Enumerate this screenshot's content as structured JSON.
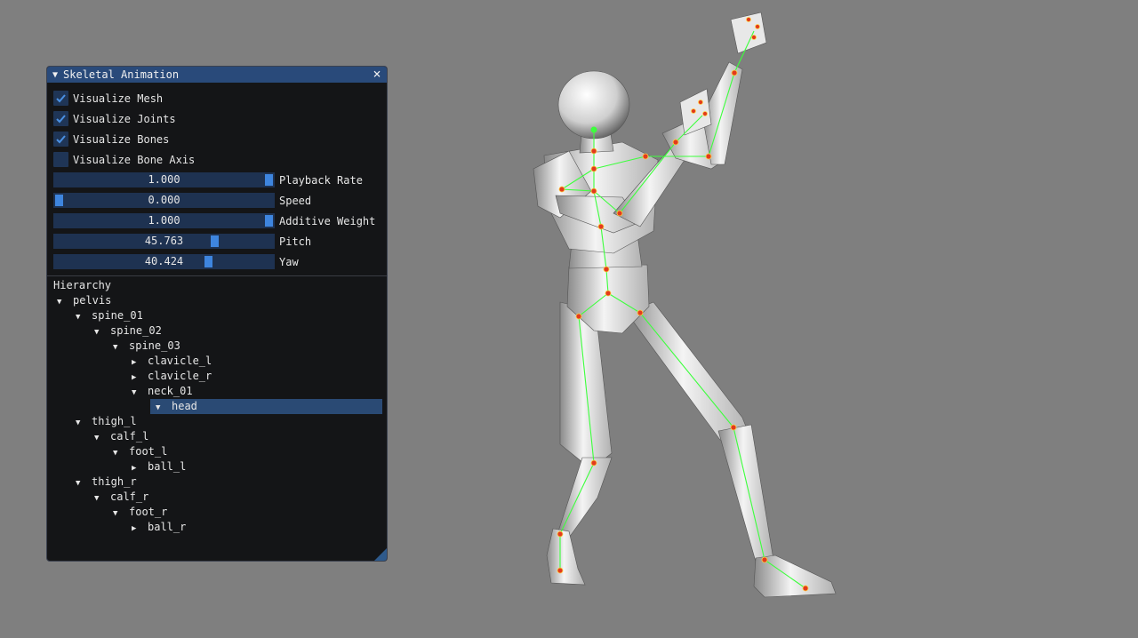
{
  "window": {
    "title": "Skeletal Animation",
    "checkboxes": [
      {
        "label": "Visualize Mesh",
        "checked": true
      },
      {
        "label": "Visualize Joints",
        "checked": true
      },
      {
        "label": "Visualize Bones",
        "checked": true
      },
      {
        "label": "Visualize Bone Axis",
        "checked": false
      }
    ],
    "sliders": [
      {
        "label": "Playback Rate",
        "value": "1.000",
        "fraction": 1.0
      },
      {
        "label": "Speed",
        "value": "0.000",
        "fraction": 0.0
      },
      {
        "label": "Additive Weight",
        "value": "1.000",
        "fraction": 1.0
      },
      {
        "label": "Pitch",
        "value": "45.763",
        "fraction": 0.74
      },
      {
        "label": "Yaw",
        "value": "40.424",
        "fraction": 0.71
      }
    ],
    "hierarchy": {
      "title": "Hierarchy",
      "nodes": [
        {
          "label": "pelvis",
          "depth": 0,
          "expanded": true,
          "selected": false
        },
        {
          "label": "spine_01",
          "depth": 1,
          "expanded": true,
          "selected": false
        },
        {
          "label": "spine_02",
          "depth": 2,
          "expanded": true,
          "selected": false
        },
        {
          "label": "spine_03",
          "depth": 3,
          "expanded": true,
          "selected": false
        },
        {
          "label": "clavicle_l",
          "depth": 4,
          "expanded": false,
          "selected": false
        },
        {
          "label": "clavicle_r",
          "depth": 4,
          "expanded": false,
          "selected": false
        },
        {
          "label": "neck_01",
          "depth": 4,
          "expanded": true,
          "selected": false
        },
        {
          "label": "head",
          "depth": 5,
          "expanded": true,
          "selected": true
        },
        {
          "label": "thigh_l",
          "depth": 1,
          "expanded": true,
          "selected": false
        },
        {
          "label": "calf_l",
          "depth": 2,
          "expanded": true,
          "selected": false
        },
        {
          "label": "foot_l",
          "depth": 3,
          "expanded": true,
          "selected": false
        },
        {
          "label": "ball_l",
          "depth": 4,
          "expanded": false,
          "selected": false
        },
        {
          "label": "thigh_r",
          "depth": 1,
          "expanded": true,
          "selected": false
        },
        {
          "label": "calf_r",
          "depth": 2,
          "expanded": true,
          "selected": false
        },
        {
          "label": "foot_r",
          "depth": 3,
          "expanded": true,
          "selected": false
        },
        {
          "label": "ball_r",
          "depth": 4,
          "expanded": false,
          "selected": false
        }
      ]
    }
  },
  "icons": {
    "collapse": "triangle-down-icon",
    "close": "close-icon",
    "check": "checkmark-icon",
    "tree_open": "triangle-down-icon",
    "tree_closed": "triangle-right-icon"
  },
  "colors": {
    "background": "#7f7f7f",
    "window_bg": "#141517",
    "title_bg": "#294a7a",
    "frame_bg": "#1e3251",
    "accent": "#3e85de",
    "selected": "#2a4a74",
    "bone": "#3cff3c",
    "joint": "#e03020"
  }
}
